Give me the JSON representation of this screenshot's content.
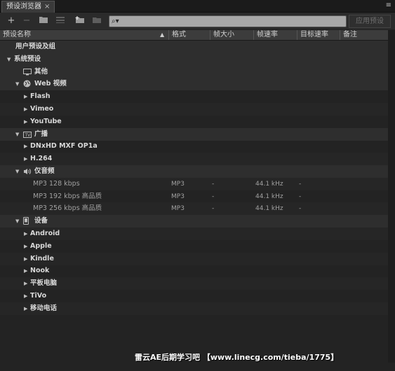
{
  "panel": {
    "tab_title": "预设浏览器",
    "tab_close": "×",
    "menu_icon": "≡"
  },
  "toolbar": {
    "buttons": [
      "plus-icon",
      "minus-icon",
      "new-folder-icon",
      "list-icon",
      "import-icon",
      "export-icon"
    ],
    "search_value": "",
    "apply_label": "应用预设"
  },
  "columns": [
    "预设名称",
    "格式",
    "帧大小",
    "帧速率",
    "目标速率",
    "备注"
  ],
  "rows": [
    {
      "level": 0,
      "label": "用户预设及组",
      "tri": "",
      "icon": "",
      "bold": true
    },
    {
      "level": 0,
      "label": "系统预设",
      "tri": "▼",
      "icon": "",
      "bold": true
    },
    {
      "level": 1,
      "label": "其他",
      "tri": "",
      "icon": "monitor-icon",
      "bold": true
    },
    {
      "level": 1,
      "label": "Web 视频",
      "tri": "▼",
      "icon": "globe-icon",
      "bold": true
    },
    {
      "level": 2,
      "label": "Flash",
      "tri": "▶",
      "icon": "",
      "bold": true
    },
    {
      "level": 2,
      "label": "Vimeo",
      "tri": "▶",
      "icon": "",
      "bold": true
    },
    {
      "level": 2,
      "label": "YouTube",
      "tri": "▶",
      "icon": "",
      "bold": true
    },
    {
      "level": 1,
      "label": "广播",
      "tri": "▼",
      "icon": "tv-icon",
      "bold": true
    },
    {
      "level": 2,
      "label": "DNxHD MXF OP1a",
      "tri": "▶",
      "icon": "",
      "bold": true
    },
    {
      "level": 2,
      "label": "H.264",
      "tri": "▶",
      "icon": "",
      "bold": true
    },
    {
      "level": 1,
      "label": "仅音频",
      "tri": "▼",
      "icon": "speaker-icon",
      "bold": true
    },
    {
      "level": 3,
      "label": "MP3 128 kbps",
      "tri": "",
      "icon": "",
      "bold": false,
      "format": "MP3",
      "frame_size": "-",
      "frame_rate": "44.1 kHz",
      "target_rate": "-"
    },
    {
      "level": 3,
      "label": "MP3 192 kbps 高品质",
      "tri": "",
      "icon": "",
      "bold": false,
      "format": "MP3",
      "frame_size": "-",
      "frame_rate": "44.1 kHz",
      "target_rate": "-"
    },
    {
      "level": 3,
      "label": "MP3 256 kbps 高品质",
      "tri": "",
      "icon": "",
      "bold": false,
      "format": "MP3",
      "frame_size": "-",
      "frame_rate": "44.1 kHz",
      "target_rate": "-"
    },
    {
      "level": 1,
      "label": "设备",
      "tri": "▼",
      "icon": "phone-icon",
      "bold": true
    },
    {
      "level": 2,
      "label": "Android",
      "tri": "▶",
      "icon": "",
      "bold": true
    },
    {
      "level": 2,
      "label": "Apple",
      "tri": "▶",
      "icon": "",
      "bold": true
    },
    {
      "level": 2,
      "label": "Kindle",
      "tri": "▶",
      "icon": "",
      "bold": true
    },
    {
      "level": 2,
      "label": "Nook",
      "tri": "▶",
      "icon": "",
      "bold": true
    },
    {
      "level": 2,
      "label": "平板电脑",
      "tri": "▶",
      "icon": "",
      "bold": true
    },
    {
      "level": 2,
      "label": "TiVo",
      "tri": "▶",
      "icon": "",
      "bold": true
    },
    {
      "level": 2,
      "label": "移动电话",
      "tri": "▶",
      "icon": "",
      "bold": true
    }
  ],
  "watermark": "雷云AE后期学习吧 【www.linecg.com/tieba/1775】"
}
